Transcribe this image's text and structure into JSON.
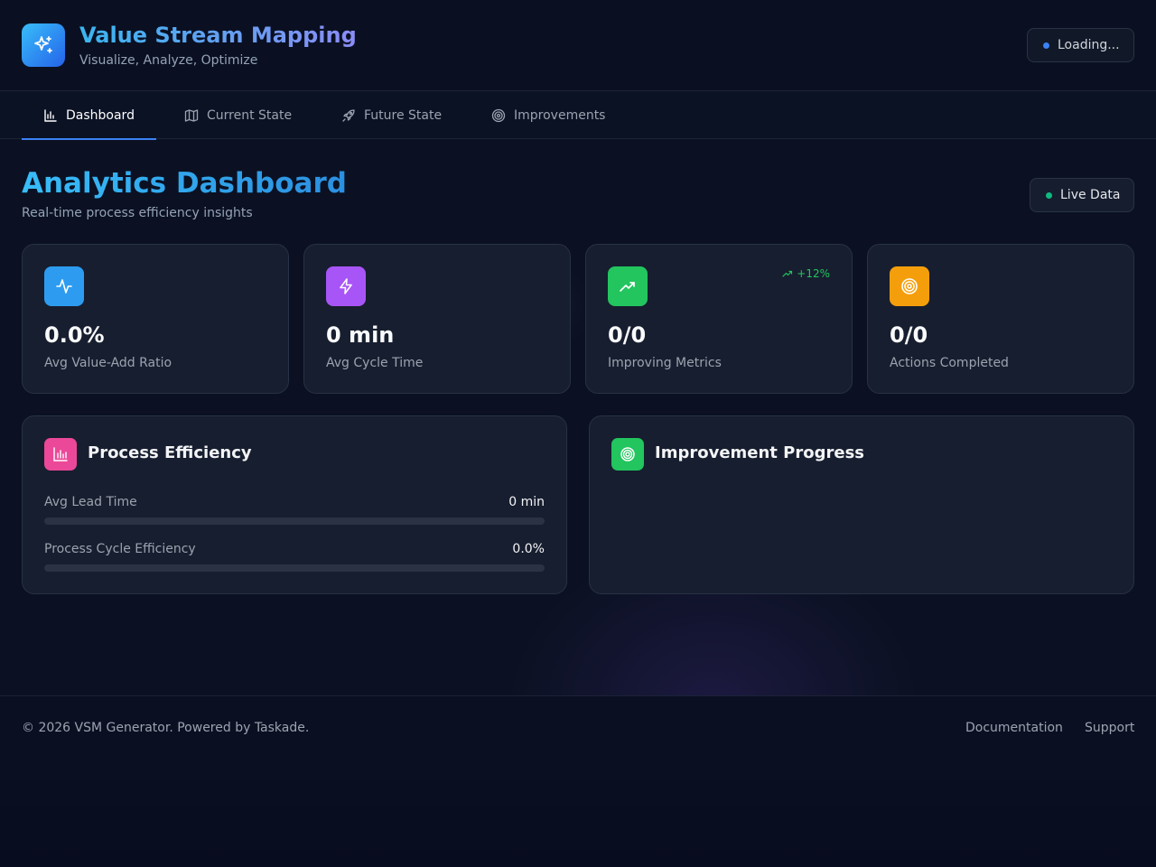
{
  "app": {
    "title": "Value Stream Mapping",
    "subtitle": "Visualize, Analyze, Optimize",
    "logo_icon": "sparkles-icon",
    "status": "Loading...",
    "status_dot_color": "#3b82f6"
  },
  "tabs": [
    {
      "label": "Dashboard",
      "icon": "bar-chart-icon",
      "active": true
    },
    {
      "label": "Current State",
      "icon": "map-icon",
      "active": false
    },
    {
      "label": "Future State",
      "icon": "rocket-icon",
      "active": false
    },
    {
      "label": "Improvements",
      "icon": "target-icon",
      "active": false
    }
  ],
  "page": {
    "title": "Analytics Dashboard",
    "subtitle": "Real-time process efficiency insights",
    "live_label": "Live Data",
    "live_dot_color": "#10b981"
  },
  "stats": [
    {
      "value": "0.0%",
      "label": "Avg Value-Add Ratio",
      "icon": "activity-icon",
      "color": "#2d9cf0"
    },
    {
      "value": "0 min",
      "label": "Avg Cycle Time",
      "icon": "zap-icon",
      "color": "#a855f7"
    },
    {
      "value": "0/0",
      "label": "Improving Metrics",
      "icon": "trending-up-icon",
      "color": "#22c55e",
      "trend": "+12%"
    },
    {
      "value": "0/0",
      "label": "Actions Completed",
      "icon": "target-icon",
      "color": "#f59e0b"
    }
  ],
  "process_efficiency": {
    "title": "Process Efficiency",
    "icon": "bar-chart-icon",
    "icon_color": "#ec4899",
    "metrics": [
      {
        "label": "Avg Lead Time",
        "value": "0 min",
        "progress": 0
      },
      {
        "label": "Process Cycle Efficiency",
        "value": "0.0%",
        "progress": 0
      }
    ]
  },
  "improvement_progress": {
    "title": "Improvement Progress",
    "icon": "target-icon",
    "icon_color": "#22c55e"
  },
  "footer": {
    "copyright": "© 2026 VSM Generator. Powered by Taskade.",
    "links": [
      "Documentation",
      "Support"
    ]
  }
}
